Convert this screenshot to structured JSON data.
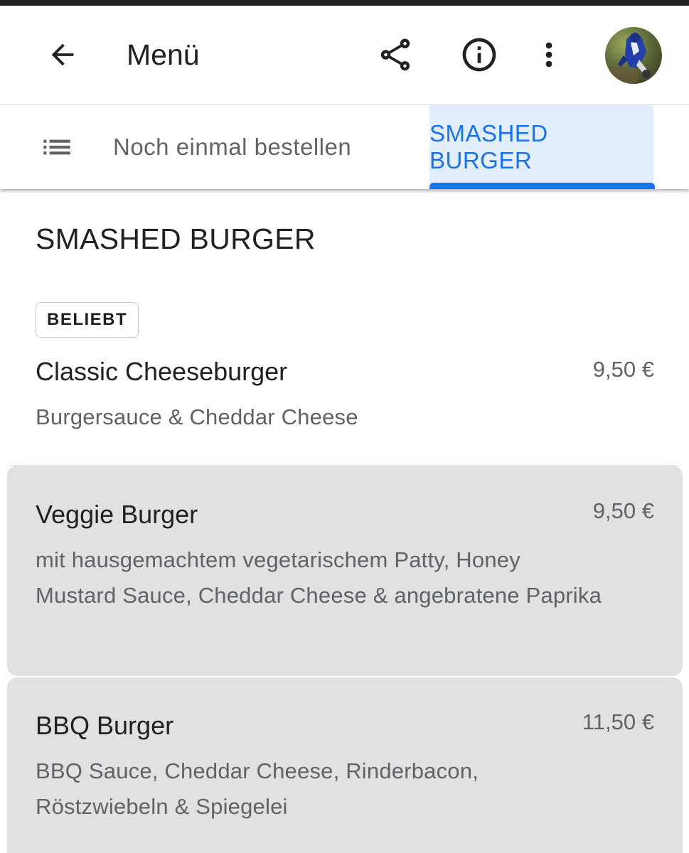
{
  "appbar": {
    "title": "Menü",
    "icons": [
      "arrow-back-icon",
      "share-icon",
      "info-icon",
      "more-vert-icon"
    ],
    "avatar": "user-avatar"
  },
  "tabs": {
    "list_icon": "list-icon",
    "items": [
      {
        "label": "Noch einmal bestellen",
        "active": false
      },
      {
        "label": "SMASHED BURGER",
        "active": true
      }
    ]
  },
  "colors": {
    "accent": "#1a73e8",
    "active_tab_bg": "#e3eefc",
    "item_bg": "#e1e1e1",
    "secondary_text": "#5f6368"
  },
  "section": {
    "title": "SMASHED BURGER",
    "items": [
      {
        "badge": "BELIEBT",
        "name": "Classic Cheeseburger",
        "price": "9,50 €",
        "description": "Burgersauce & Cheddar Cheese"
      },
      {
        "name": "Veggie Burger",
        "price": "9,50 €",
        "description": "mit hausgemachtem vegetarischem Patty, Honey Mustard Sauce, Cheddar Cheese & angebratene Paprika"
      },
      {
        "name": "BBQ Burger",
        "price": "11,50 €",
        "description": "BBQ Sauce, Cheddar Cheese, Rinderbacon, Röstzwiebeln & Spiegelei"
      }
    ]
  }
}
